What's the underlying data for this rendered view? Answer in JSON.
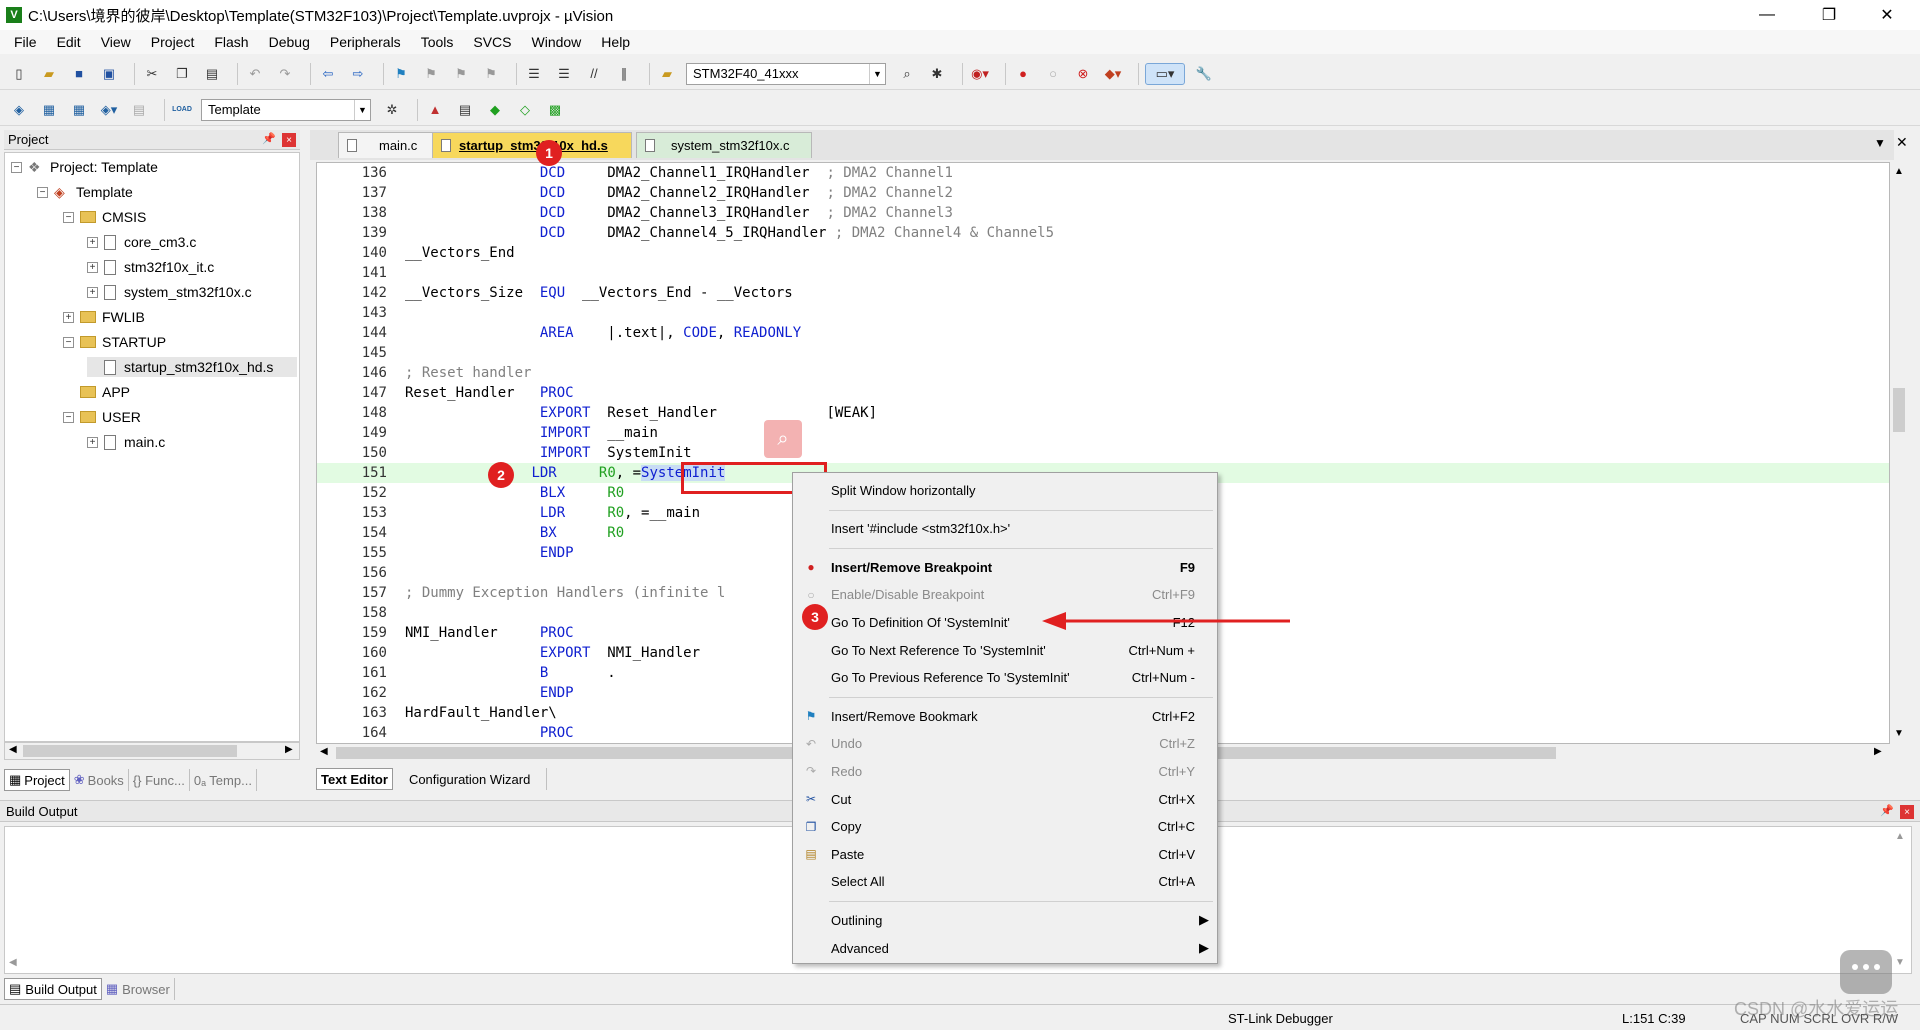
{
  "window": {
    "title": "C:\\Users\\境界的彼岸\\Desktop\\Template(STM32F103)\\Project\\Template.uvprojx - µVision",
    "minimize": "—",
    "restore": "❐",
    "close": "✕"
  },
  "menu": [
    "File",
    "Edit",
    "View",
    "Project",
    "Flash",
    "Debug",
    "Peripherals",
    "Tools",
    "SVCS",
    "Window",
    "Help"
  ],
  "toolbar1": {
    "device_combo": "STM32F40_41xxx"
  },
  "toolbar2": {
    "target_combo": "Template",
    "load_label": "LOAD"
  },
  "project_panel": {
    "title": "Project",
    "tree": [
      {
        "label": "Project: Template",
        "kind": "project",
        "level": 0,
        "expander": "−"
      },
      {
        "label": "Template",
        "kind": "target",
        "level": 1,
        "expander": "−"
      },
      {
        "label": "CMSIS",
        "kind": "folder",
        "level": 2,
        "expander": "−"
      },
      {
        "label": "core_cm3.c",
        "kind": "file",
        "level": 3,
        "expander": "+"
      },
      {
        "label": "stm32f10x_it.c",
        "kind": "file",
        "level": 3,
        "expander": "+"
      },
      {
        "label": "system_stm32f10x.c",
        "kind": "file",
        "level": 3,
        "expander": "+"
      },
      {
        "label": "FWLIB",
        "kind": "folder",
        "level": 2,
        "expander": "+"
      },
      {
        "label": "STARTUP",
        "kind": "folder",
        "level": 2,
        "expander": "−"
      },
      {
        "label": "startup_stm32f10x_hd.s",
        "kind": "file",
        "level": 3,
        "expander": ""
      },
      {
        "label": "APP",
        "kind": "folder",
        "level": 2,
        "expander": ""
      },
      {
        "label": "USER",
        "kind": "folder",
        "level": 2,
        "expander": "−"
      },
      {
        "label": "main.c",
        "kind": "file",
        "level": 3,
        "expander": "+"
      }
    ],
    "bottom_tabs": [
      "Project",
      "Books",
      "{} Func...",
      "0ₐ Temp..."
    ]
  },
  "editor": {
    "tabs": [
      {
        "label": "main.c",
        "active": false
      },
      {
        "label": "startup_stm32f10x_hd.s",
        "active": true
      },
      {
        "label": "system_stm32f10x.c",
        "active": false
      }
    ],
    "lines": [
      {
        "n": "136",
        "t": [
          [
            "",
            "                "
          ],
          [
            "kw",
            "DCD"
          ],
          [
            "",
            "     DMA2_Channel1_IRQHandler  "
          ],
          [
            "cm",
            "; DMA2 Channel1"
          ]
        ]
      },
      {
        "n": "137",
        "t": [
          [
            "",
            "                "
          ],
          [
            "kw",
            "DCD"
          ],
          [
            "",
            "     DMA2_Channel2_IRQHandler  "
          ],
          [
            "cm",
            "; DMA2 Channel2"
          ]
        ]
      },
      {
        "n": "138",
        "t": [
          [
            "",
            "                "
          ],
          [
            "kw",
            "DCD"
          ],
          [
            "",
            "     DMA2_Channel3_IRQHandler  "
          ],
          [
            "cm",
            "; DMA2 Channel3"
          ]
        ]
      },
      {
        "n": "139",
        "t": [
          [
            "",
            "                "
          ],
          [
            "kw",
            "DCD"
          ],
          [
            "",
            "     DMA2_Channel4_5_IRQHandler "
          ],
          [
            "cm",
            "; DMA2 Channel4 & Channel5"
          ]
        ]
      },
      {
        "n": "140",
        "t": [
          [
            "",
            "__Vectors_End"
          ]
        ]
      },
      {
        "n": "141",
        "t": []
      },
      {
        "n": "142",
        "t": [
          [
            "",
            "__Vectors_Size  "
          ],
          [
            "kw",
            "EQU"
          ],
          [
            "",
            "  __Vectors_End - __Vectors"
          ]
        ]
      },
      {
        "n": "143",
        "t": []
      },
      {
        "n": "144",
        "t": [
          [
            "",
            "                "
          ],
          [
            "kw",
            "AREA"
          ],
          [
            "",
            "    |.text|, "
          ],
          [
            "kw",
            "CODE"
          ],
          [
            "",
            ", "
          ],
          [
            "kw",
            "READONLY"
          ]
        ]
      },
      {
        "n": "145",
        "t": []
      },
      {
        "n": "146",
        "t": [
          [
            "cm",
            "; Reset handler"
          ]
        ]
      },
      {
        "n": "147",
        "t": [
          [
            "",
            "Reset_Handler   "
          ],
          [
            "kw",
            "PROC"
          ]
        ]
      },
      {
        "n": "148",
        "t": [
          [
            "",
            "                "
          ],
          [
            "kw",
            "EXPORT"
          ],
          [
            "",
            "  Reset_Handler             [WEAK]"
          ]
        ]
      },
      {
        "n": "149",
        "t": [
          [
            "",
            "                "
          ],
          [
            "kw",
            "IMPORT"
          ],
          [
            "",
            "  __main"
          ]
        ]
      },
      {
        "n": "150",
        "t": [
          [
            "",
            "                "
          ],
          [
            "kw",
            "IMPORT"
          ],
          [
            "",
            "  SystemInit"
          ]
        ]
      },
      {
        "n": "151",
        "t": [
          [
            "",
            "               "
          ],
          [
            "kw",
            "LDR"
          ],
          [
            "",
            "     "
          ],
          [
            "reg",
            "R0"
          ],
          [
            "",
            ", ="
          ],
          [
            "sel",
            "SystemInit"
          ]
        ],
        "hl": true
      },
      {
        "n": "152",
        "t": [
          [
            "",
            "                "
          ],
          [
            "kw",
            "BLX"
          ],
          [
            "",
            "     "
          ],
          [
            "reg",
            "R0"
          ]
        ]
      },
      {
        "n": "153",
        "t": [
          [
            "",
            "                "
          ],
          [
            "kw",
            "LDR"
          ],
          [
            "",
            "     "
          ],
          [
            "reg",
            "R0"
          ],
          [
            "",
            ", =__main"
          ]
        ]
      },
      {
        "n": "154",
        "t": [
          [
            "",
            "                "
          ],
          [
            "kw",
            "BX"
          ],
          [
            "",
            "      "
          ],
          [
            "reg",
            "R0"
          ]
        ]
      },
      {
        "n": "155",
        "t": [
          [
            "",
            "                "
          ],
          [
            "kw",
            "ENDP"
          ]
        ]
      },
      {
        "n": "156",
        "t": []
      },
      {
        "n": "157",
        "t": [
          [
            "cm",
            "; Dummy Exception Handlers (infinite l"
          ]
        ]
      },
      {
        "n": "158",
        "t": []
      },
      {
        "n": "159",
        "t": [
          [
            "",
            "NMI_Handler     "
          ],
          [
            "kw",
            "PROC"
          ]
        ]
      },
      {
        "n": "160",
        "t": [
          [
            "",
            "                "
          ],
          [
            "kw",
            "EXPORT"
          ],
          [
            "",
            "  NMI_Handler"
          ]
        ]
      },
      {
        "n": "161",
        "t": [
          [
            "",
            "                "
          ],
          [
            "kw",
            "B"
          ],
          [
            "",
            "       ."
          ]
        ]
      },
      {
        "n": "162",
        "t": [
          [
            "",
            "                "
          ],
          [
            "kw",
            "ENDP"
          ]
        ]
      },
      {
        "n": "163",
        "t": [
          [
            "",
            "HardFault_Handler\\"
          ]
        ]
      },
      {
        "n": "164",
        "t": [
          [
            "",
            "                "
          ],
          [
            "kw",
            "PROC"
          ]
        ]
      }
    ],
    "bottom_tabs": [
      "Text Editor",
      "Configuration Wizard"
    ]
  },
  "context_menu": [
    {
      "label": "Split Window horizontally",
      "shortcut": "",
      "icon": "",
      "state": "normal"
    },
    {
      "sep": true
    },
    {
      "label": "Insert '#include <stm32f10x.h>'",
      "shortcut": "",
      "icon": "",
      "state": "normal"
    },
    {
      "sep": true
    },
    {
      "label": "Insert/Remove Breakpoint",
      "shortcut": "F9",
      "icon": "breakpoint",
      "state": "bold"
    },
    {
      "label": "Enable/Disable Breakpoint",
      "shortcut": "Ctrl+F9",
      "icon": "breakpoint-hollow",
      "state": "disabled"
    },
    {
      "label": "Go To Definition Of 'SystemInit'",
      "shortcut": "F12",
      "icon": "",
      "state": "normal"
    },
    {
      "label": "Go To Next Reference To 'SystemInit'",
      "shortcut": "Ctrl+Num +",
      "icon": "",
      "state": "normal"
    },
    {
      "label": "Go To Previous Reference To 'SystemInit'",
      "shortcut": "Ctrl+Num -",
      "icon": "",
      "state": "normal"
    },
    {
      "sep": true
    },
    {
      "label": "Insert/Remove Bookmark",
      "shortcut": "Ctrl+F2",
      "icon": "bookmark",
      "state": "normal"
    },
    {
      "label": "Undo",
      "shortcut": "Ctrl+Z",
      "icon": "undo",
      "state": "disabled"
    },
    {
      "label": "Redo",
      "shortcut": "Ctrl+Y",
      "icon": "redo",
      "state": "disabled"
    },
    {
      "label": "Cut",
      "shortcut": "Ctrl+X",
      "icon": "cut",
      "state": "normal"
    },
    {
      "label": "Copy",
      "shortcut": "Ctrl+C",
      "icon": "copy",
      "state": "normal"
    },
    {
      "label": "Paste",
      "shortcut": "Ctrl+V",
      "icon": "paste",
      "state": "normal"
    },
    {
      "label": "Select All",
      "shortcut": "Ctrl+A",
      "icon": "",
      "state": "normal"
    },
    {
      "sep": true
    },
    {
      "label": "Outlining",
      "shortcut": "▶",
      "icon": "",
      "state": "normal"
    },
    {
      "label": "Advanced",
      "shortcut": "▶",
      "icon": "",
      "state": "normal"
    }
  ],
  "annotations": {
    "badge1": "1",
    "badge2": "2",
    "badge3": "3"
  },
  "build_output": {
    "title": "Build Output",
    "bottom_tabs": [
      "Build Output",
      "Browser"
    ]
  },
  "status": {
    "debugger": "ST-Link Debugger",
    "position": "L:151 C:39",
    "flags": "CAP  NUM  SCRL  OVR  R/W",
    "watermark": "CSDN @水水爱运运"
  },
  "colors": {
    "keyword": "#1020d0",
    "comment": "#808080",
    "register": "#20a020",
    "line_highlight": "#e2fbe2",
    "annotation_red": "#e02020"
  }
}
